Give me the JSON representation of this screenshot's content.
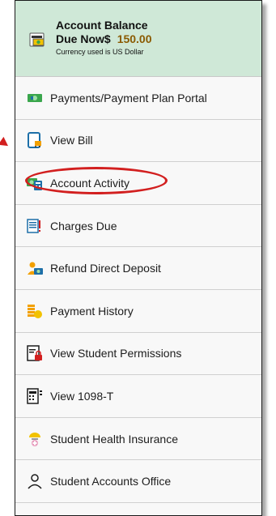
{
  "balance": {
    "title": "Account Balance",
    "due_label": "Due Now$",
    "amount": "150.00",
    "note": "Currency used is US Dollar",
    "icon": "money-wallet-icon"
  },
  "menu": {
    "items": [
      {
        "label": "Payments/Payment Plan Portal",
        "icon": "cash-payment-icon"
      },
      {
        "label": "View Bill",
        "icon": "device-bill-icon"
      },
      {
        "label": "Account Activity",
        "icon": "money-calculator-icon",
        "highlighted": true
      },
      {
        "label": "Charges Due",
        "icon": "invoice-list-icon"
      },
      {
        "label": "Refund Direct Deposit",
        "icon": "person-refund-icon"
      },
      {
        "label": "Payment History",
        "icon": "coins-history-icon"
      },
      {
        "label": "View Student Permissions",
        "icon": "document-lock-icon"
      },
      {
        "label": "View 1098-T",
        "icon": "tax-form-icon"
      },
      {
        "label": "Student Health Insurance",
        "icon": "health-insurance-icon"
      },
      {
        "label": "Student Accounts Office",
        "icon": "person-office-icon"
      }
    ]
  },
  "colors": {
    "balance_bg": "#cfe8d7",
    "amount": "#8a5a00",
    "annotation": "#d21f1f"
  }
}
